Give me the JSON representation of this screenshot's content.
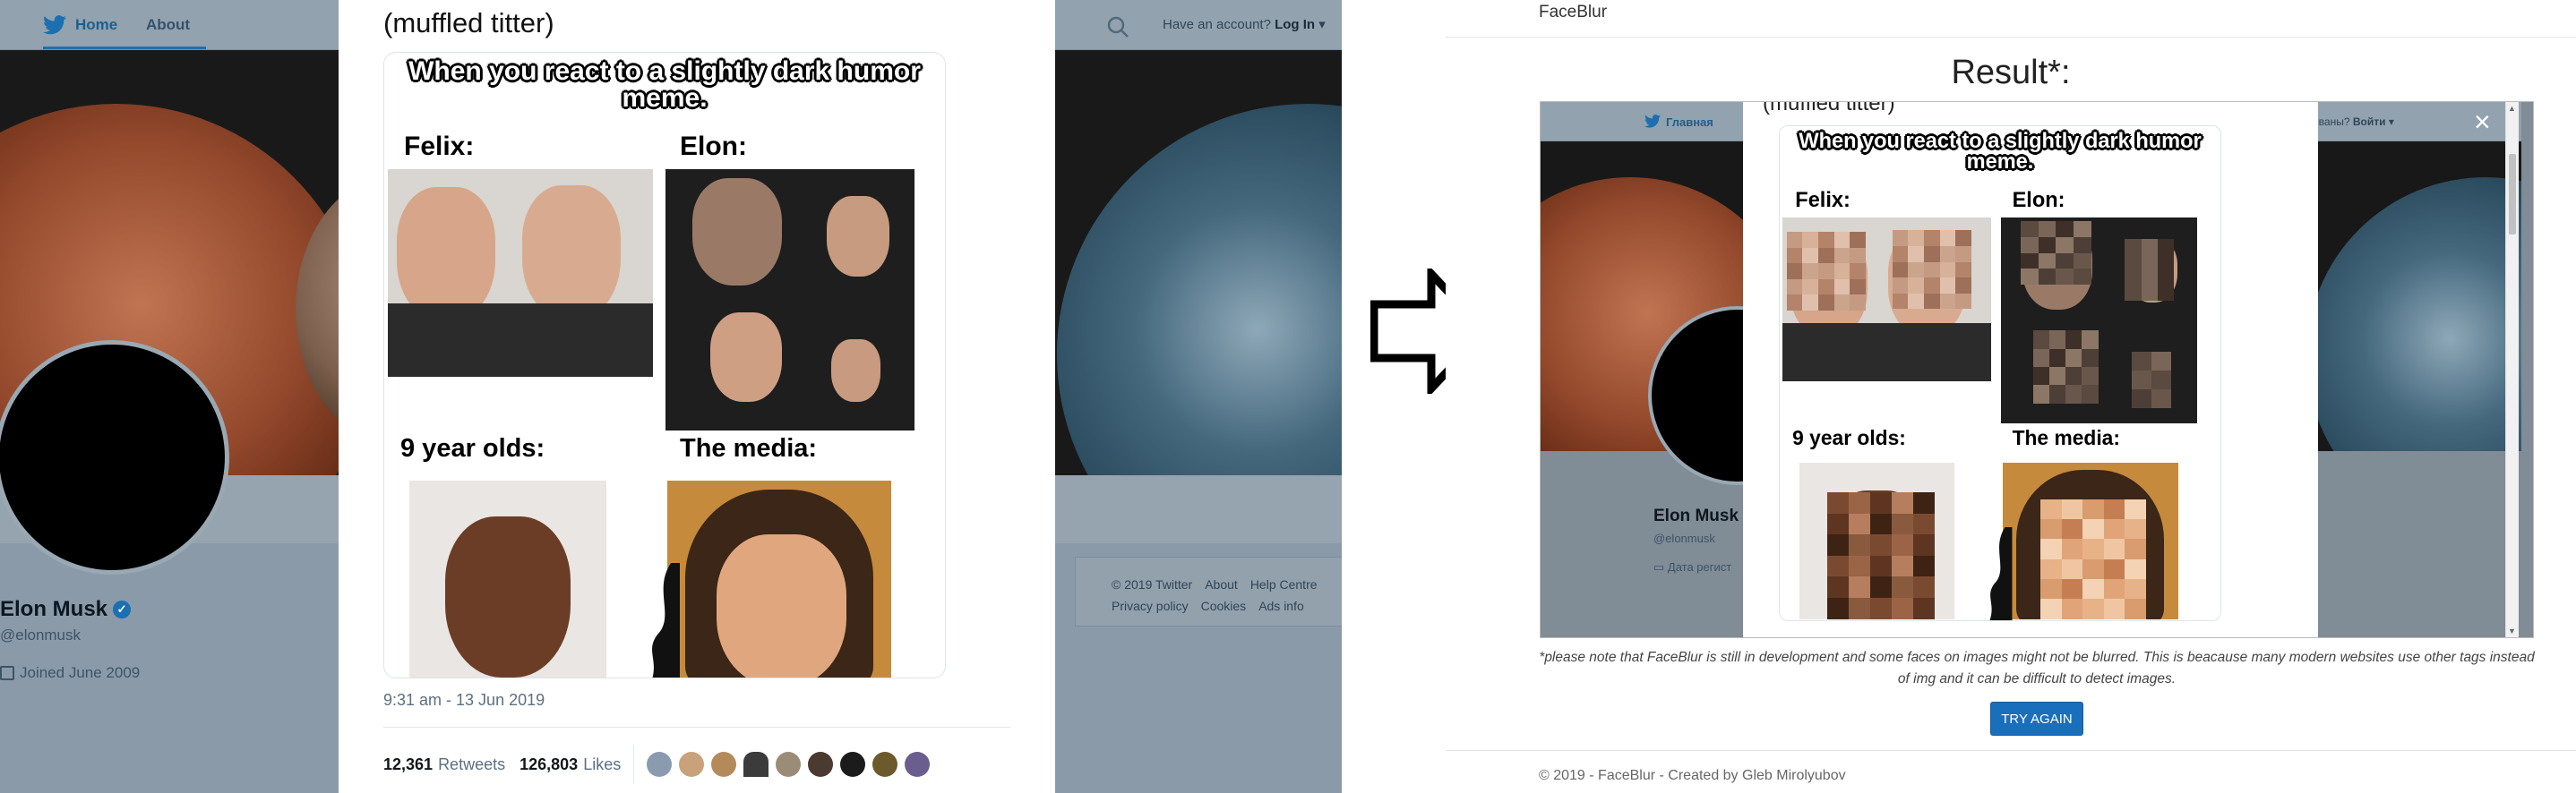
{
  "original": {
    "nav": {
      "home": "Home",
      "about": "About",
      "account_prefix": "Have an account?",
      "login": "Log In"
    },
    "profile": {
      "name": "Elon Musk",
      "handle": "@elonmusk",
      "joined": "Joined June 2009"
    },
    "footer": {
      "row1": [
        "© 2019 Twitter",
        "About",
        "Help Centre"
      ],
      "row2": [
        "Privacy policy",
        "Cookies",
        "Ads info"
      ]
    },
    "tweet": {
      "caption": "(muffled titter)",
      "timestamp": "9:31 am - 13 Jun 2019",
      "retweets": "12,361",
      "retweets_label": "Retweets",
      "likes": "126,803",
      "likes_label": "Likes"
    }
  },
  "meme": {
    "title": "When you react to a slightly dark humor meme.",
    "felix": "Felix:",
    "elon": "Elon:",
    "nine": "9 year olds:",
    "media": "The media:"
  },
  "faceblur": {
    "brand": "FaceBlur",
    "result": "Result*:",
    "note": "*please note that FaceBlur is still in development and some faces on images might not be blurred. This is beacause many modern websites use other tags instead of img and it can be difficult to detect images.",
    "button": "TRY AGAIN",
    "footer": "© 2019 - FaceBlur - Created by Gleb Mirolyubov",
    "embedded": {
      "home": "Главная",
      "account_suffix": "ованы?",
      "login": "Войти",
      "name": "Elon Musk",
      "handle": "@elonmusk",
      "joined": "Дата регист",
      "close": "×"
    }
  },
  "colors": {
    "twitter_blue": "#1c6fb0",
    "button_blue": "#1a6fbd"
  }
}
